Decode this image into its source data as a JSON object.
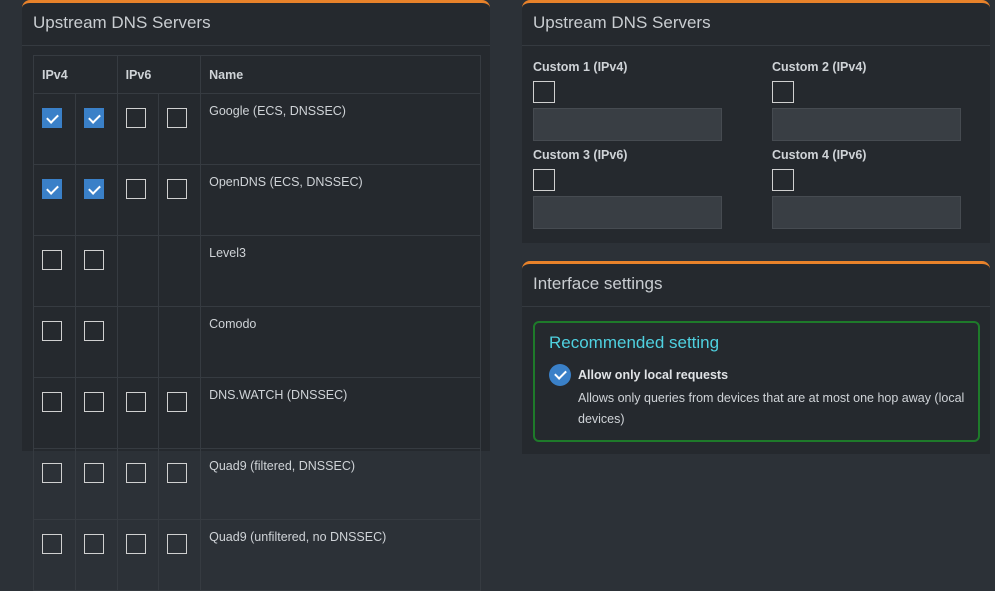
{
  "left": {
    "title": "Upstream DNS Servers",
    "headers": {
      "ipv4": "IPv4",
      "ipv6": "IPv6",
      "name": "Name"
    },
    "rows": [
      {
        "name": "Google (ECS, DNSSEC)",
        "v4": [
          true,
          true
        ],
        "v6": [
          false,
          false
        ]
      },
      {
        "name": "OpenDNS (ECS, DNSSEC)",
        "v4": [
          true,
          true
        ],
        "v6": [
          false,
          false
        ]
      },
      {
        "name": "Level3",
        "v4": [
          false,
          false
        ],
        "v6": null
      },
      {
        "name": "Comodo",
        "v4": [
          false,
          false
        ],
        "v6": null
      },
      {
        "name": "DNS.WATCH (DNSSEC)",
        "v4": [
          false,
          false
        ],
        "v6": [
          false,
          false
        ]
      },
      {
        "name": "Quad9 (filtered, DNSSEC)",
        "v4": [
          false,
          false
        ],
        "v6": [
          false,
          false
        ]
      },
      {
        "name": "Quad9 (unfiltered, no DNSSEC)",
        "v4": [
          false,
          false
        ],
        "v6": [
          false,
          false
        ]
      }
    ]
  },
  "right": {
    "title": "Upstream DNS Servers",
    "custom": [
      {
        "label": "Custom 1 (IPv4)",
        "value": ""
      },
      {
        "label": "Custom 2 (IPv4)",
        "value": ""
      },
      {
        "label": "Custom 3 (IPv6)",
        "value": ""
      },
      {
        "label": "Custom 4 (IPv6)",
        "value": ""
      }
    ]
  },
  "interface": {
    "title": "Interface settings",
    "recommended": "Recommended setting",
    "option_label": "Allow only local requests",
    "option_desc": "Allows only queries from devices that are at most one hop away (local devices)",
    "checked": true
  }
}
